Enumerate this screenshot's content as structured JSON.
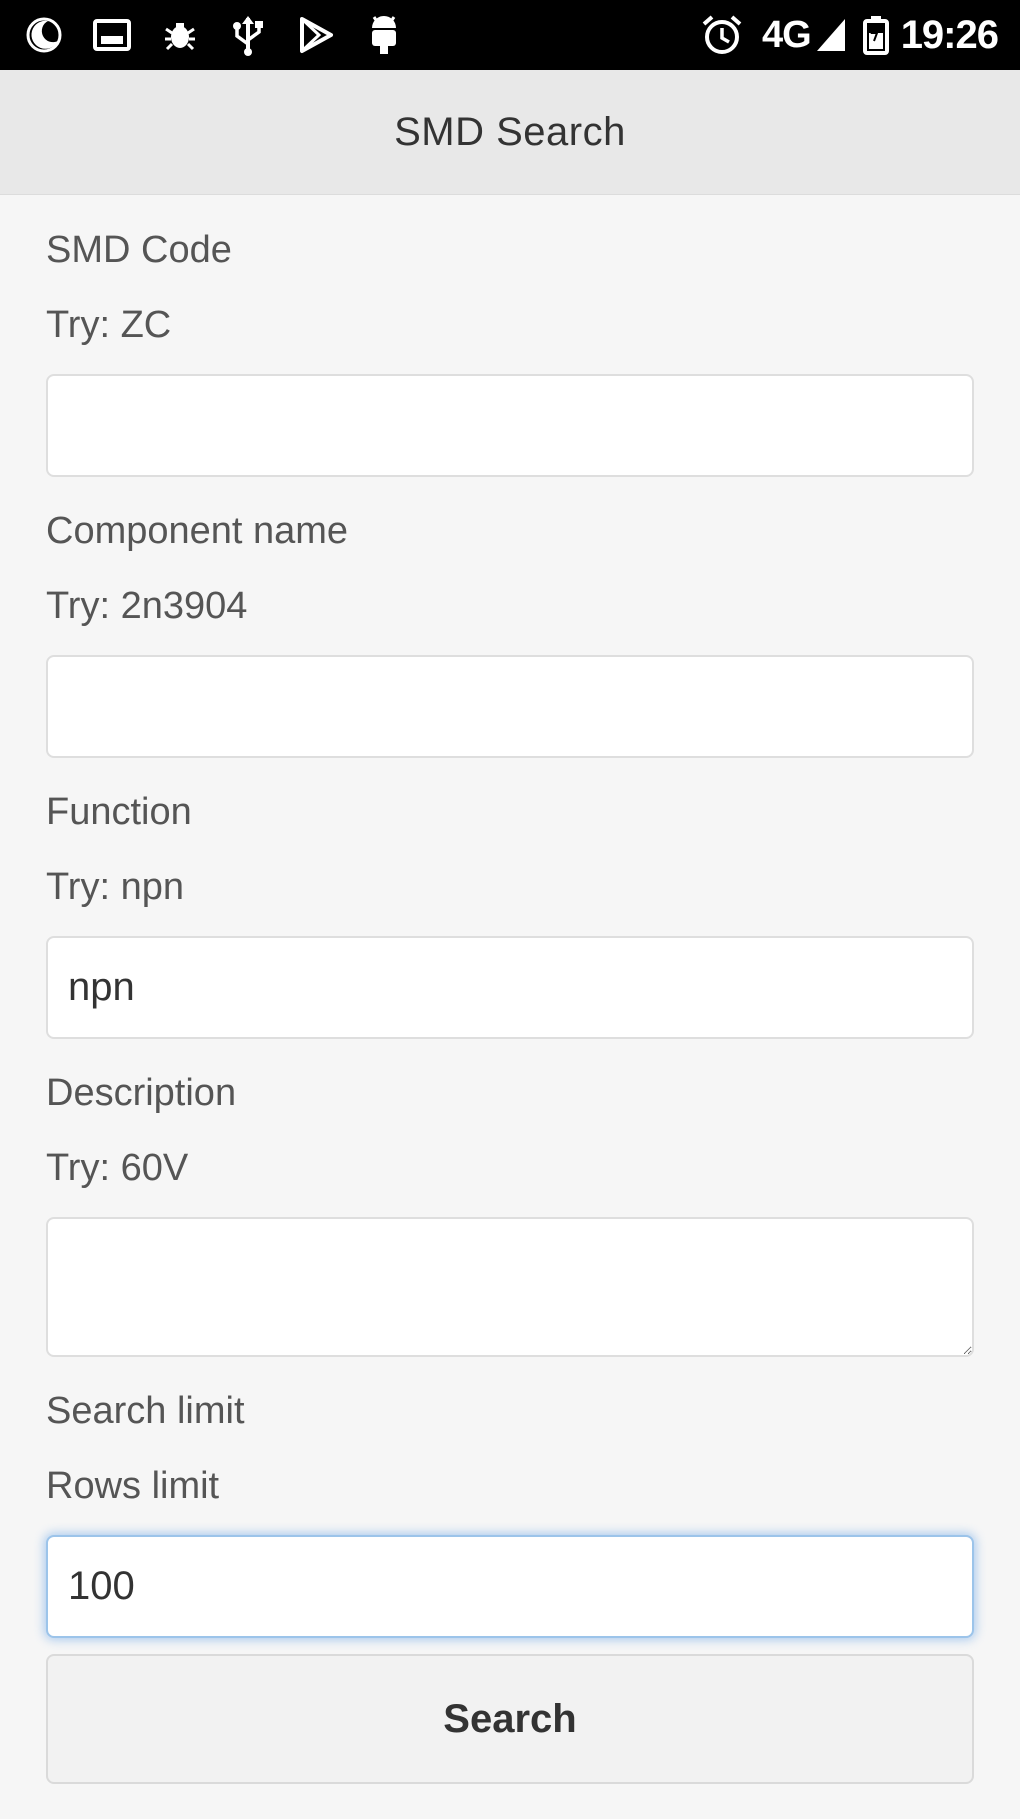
{
  "status_bar": {
    "left_icons": [
      "moon-icon",
      "image-icon",
      "bug-icon",
      "usb-icon",
      "play-store-icon",
      "android-debug-icon"
    ],
    "right_icons": [
      "alarm-icon",
      "signal-icon",
      "battery-icon"
    ],
    "network": "4G",
    "time": "19:26"
  },
  "header": {
    "title": "SMD Search"
  },
  "form": {
    "smd_code": {
      "label": "SMD Code",
      "hint": "Try: ZC",
      "value": ""
    },
    "component_name": {
      "label": "Component name",
      "hint": "Try: 2n3904",
      "value": ""
    },
    "function": {
      "label": "Function",
      "hint": "Try: npn",
      "value": "npn"
    },
    "description": {
      "label": "Description",
      "hint": "Try: 60V",
      "value": ""
    },
    "search_limit": {
      "label": "Search limit",
      "hint": "Rows limit",
      "value": "100"
    },
    "search_button": "Search"
  },
  "colors": {
    "status_bar_bg": "#000000",
    "header_bg": "#e8e8e8",
    "page_bg": "#f6f6f6",
    "focus_ring": "#5096e6"
  }
}
